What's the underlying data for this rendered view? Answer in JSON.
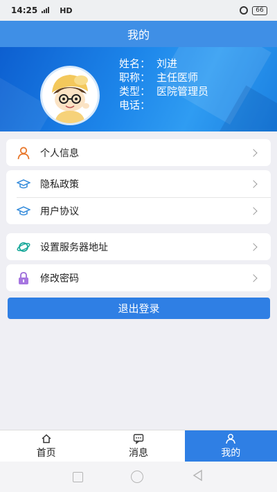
{
  "status_bar": {
    "time": "14:25",
    "network": "HD",
    "signal": "4G",
    "battery": "66"
  },
  "header": {
    "title": "我的"
  },
  "profile": {
    "name_label": "姓名：",
    "name_value": "刘进",
    "title_label": "职称：",
    "title_value": "主任医师",
    "type_label": "类型：",
    "type_value": "医院管理员",
    "phone_label": "电话：",
    "phone_value": ""
  },
  "menu": {
    "personal_info": "个人信息",
    "privacy_policy": "隐私政策",
    "user_agreement": "用户协议",
    "server_address": "设置服务器地址",
    "change_password": "修改密码"
  },
  "logout": {
    "label": "退出登录"
  },
  "tabs": [
    {
      "label": "首页",
      "icon": "home-icon"
    },
    {
      "label": "消息",
      "icon": "message-icon"
    },
    {
      "label": "我的",
      "icon": "user-icon"
    }
  ],
  "colors": {
    "primary": "#2f7fe4",
    "header": "#3f8fe6",
    "background": "#efeff4"
  }
}
